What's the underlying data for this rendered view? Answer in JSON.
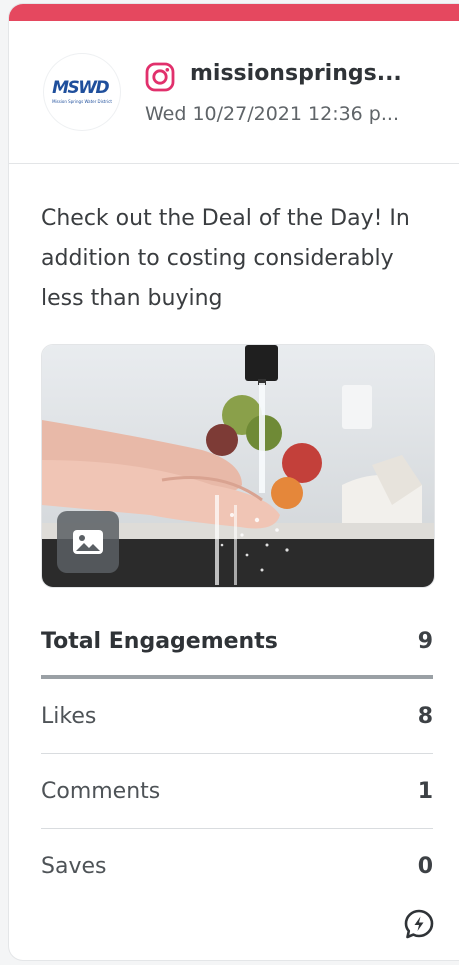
{
  "colors": {
    "accent_bar": "#e5485f",
    "instagram": "#e1306c",
    "brand_blue": "#1f4f9c"
  },
  "post": {
    "avatar": {
      "logo_text": "MSWD",
      "logo_subtext": "Mission Springs Water District"
    },
    "network_icon": "instagram-icon",
    "handle": "missionsprings...",
    "date": "Wed 10/27/2021 12:36 p...",
    "text": "Check out the Deal of the Day! In addition to costing considerably less than buying",
    "media_type_icon": "image-icon"
  },
  "metrics": {
    "total_label": "Total Engagements",
    "total_value": "9",
    "rows": [
      {
        "label": "Likes",
        "value": "8"
      },
      {
        "label": "Comments",
        "value": "1"
      },
      {
        "label": "Saves",
        "value": "0"
      }
    ]
  },
  "footer_icon": "boost-post-icon"
}
